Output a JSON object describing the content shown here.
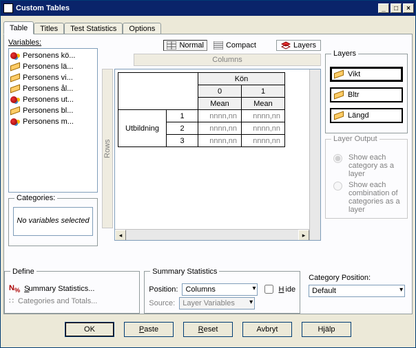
{
  "window": {
    "title": "Custom Tables"
  },
  "tabs": [
    "Table",
    "Titles",
    "Test Statistics",
    "Options"
  ],
  "activeTab": 0,
  "variables": {
    "label": "Variables:",
    "items": [
      {
        "type": "nominal",
        "label": "Personens kö..."
      },
      {
        "type": "scale",
        "label": "Personens lä..."
      },
      {
        "type": "scale",
        "label": "Personens vi..."
      },
      {
        "type": "scale",
        "label": "Personens ål..."
      },
      {
        "type": "nominal",
        "label": "Personens ut..."
      },
      {
        "type": "scale",
        "label": "Personens bl..."
      },
      {
        "type": "nominal",
        "label": "Personens m..."
      }
    ]
  },
  "categories": {
    "label": "Categories:",
    "empty_text": "No variables selected"
  },
  "toolbar": {
    "normal": "Normal",
    "compact": "Compact",
    "layers": "Layers"
  },
  "preview": {
    "columns_label": "Columns",
    "rows_label": "Rows",
    "col_header": "Kön",
    "col_cats": [
      "0",
      "1"
    ],
    "stat_label": "Mean",
    "row_header": "Utbildning",
    "rows": [
      "1",
      "2",
      "3"
    ],
    "cell_placeholder": "nnnn,nn"
  },
  "layers": {
    "label": "Layers",
    "items": [
      "Vikt",
      "Bltr",
      "Längd"
    ],
    "selected": 0,
    "output_label": "Layer Output",
    "opt1": "Show each category as a layer",
    "opt2": "Show each combination of categories as a layer"
  },
  "define": {
    "label": "Define",
    "sumstats": "Summary Statistics...",
    "cats": "Categories and Totals..."
  },
  "summary": {
    "label": "Summary Statistics",
    "position_label": "Position:",
    "position_value": "Columns",
    "hide_label": "Hide",
    "source_label": "Source:",
    "source_value": "Layer Variables"
  },
  "catpos": {
    "label": "Category Position:",
    "value": "Default"
  },
  "buttons": {
    "ok": "OK",
    "paste": "Paste",
    "reset": "Reset",
    "cancel": "Avbryt",
    "help": "Hjälp"
  }
}
